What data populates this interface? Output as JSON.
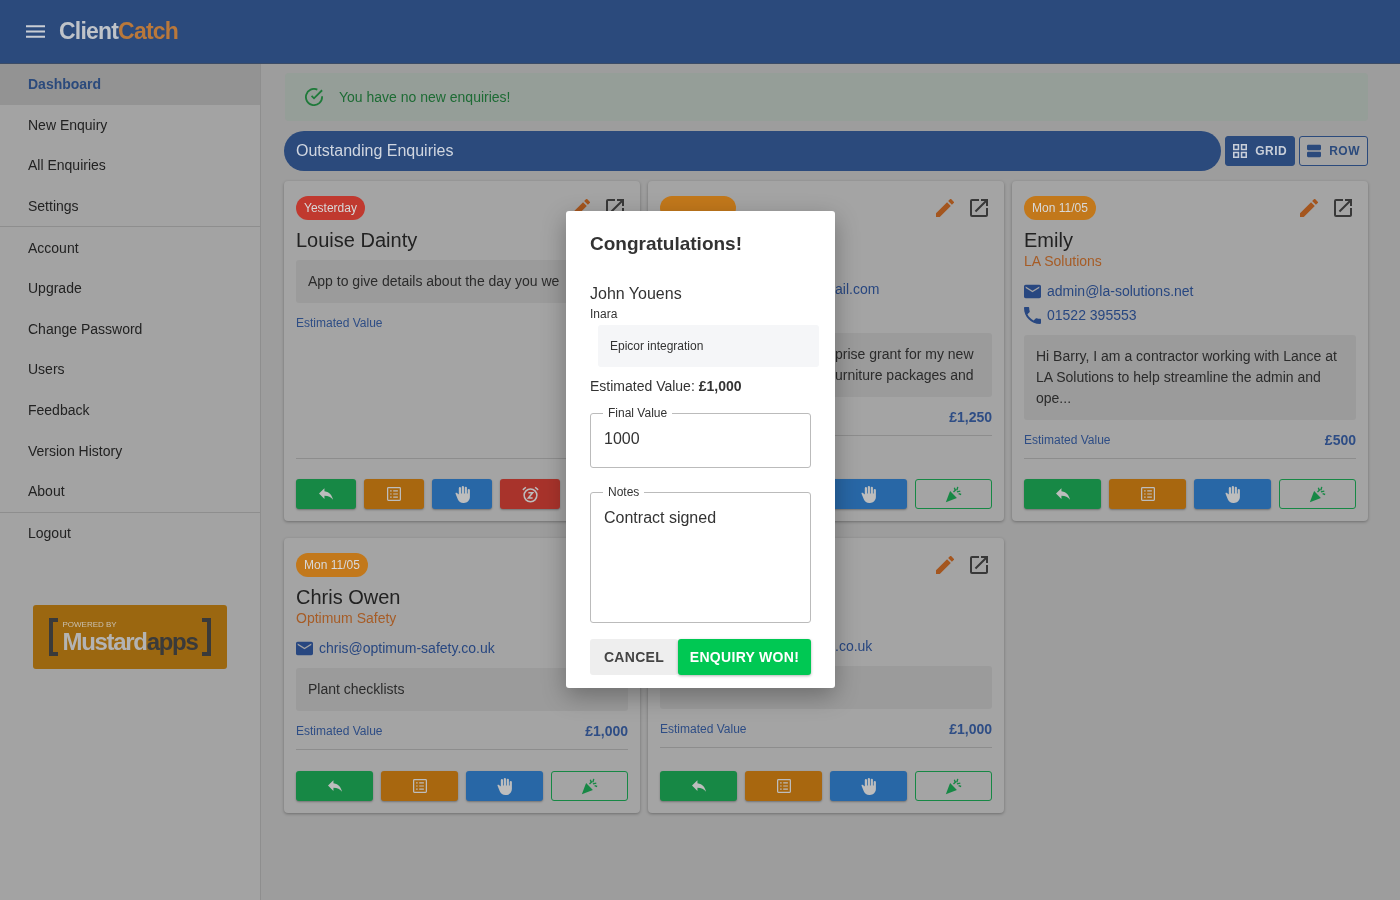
{
  "header": {
    "brand": {
      "primary": "Client",
      "accent": "Catch"
    }
  },
  "sidebar": {
    "groups": [
      [
        {
          "label": "Dashboard",
          "selected": true
        },
        {
          "label": "New Enquiry",
          "selected": false
        },
        {
          "label": "All Enquiries",
          "selected": false
        },
        {
          "label": "Settings",
          "selected": false
        }
      ],
      [
        {
          "label": "Account",
          "selected": false
        },
        {
          "label": "Upgrade",
          "selected": false
        },
        {
          "label": "Change Password",
          "selected": false
        },
        {
          "label": "Users",
          "selected": false
        },
        {
          "label": "Feedback",
          "selected": false
        },
        {
          "label": "Version History",
          "selected": false
        },
        {
          "label": "About",
          "selected": false
        }
      ],
      [
        {
          "label": "Logout",
          "selected": false
        }
      ]
    ],
    "powered_by": {
      "caption": "POWERED BY",
      "name": "Mustard",
      "accent": "apps"
    }
  },
  "alert": {
    "text": "You have no new enquiries!"
  },
  "section": {
    "title": "Outstanding Enquiries"
  },
  "view_toggle": [
    {
      "label": "GRID",
      "kind": "grid",
      "selected": true
    },
    {
      "label": "ROW",
      "kind": "row",
      "selected": false
    }
  ],
  "cards": [
    {
      "badge": {
        "text": "Yesterday",
        "color": "#c0392f"
      },
      "editable": true,
      "name": "Louise Dainty",
      "description": [
        "App to give details about the day you we"
      ],
      "value_label": "Estimated Value",
      "actions": [
        {
          "kind": "reply"
        },
        {
          "kind": "notes"
        },
        {
          "kind": "hold"
        },
        {
          "kind": "snooze"
        }
      ]
    },
    {
      "badge": {
        "color": "#c2781b"
      },
      "editable": true,
      "email": "ail.com",
      "description": [
        "prise grant for my new",
        "urniture packages and"
      ],
      "value": "£1,250",
      "actions": [
        {
          "kind": "hold"
        },
        {
          "kind": "won"
        }
      ]
    },
    {
      "badge": {
        "text": "Mon 11/05",
        "color": "#c2781b"
      },
      "editable": true,
      "name": "Emily",
      "company": "LA Solutions",
      "email": "admin@la-solutions.net",
      "phone": "01522 395553",
      "description": [
        "Hi Barry, I am a contractor working with Lance at LA Solutions to help streamline the admin and ope..."
      ],
      "value_label": "Estimated Value",
      "value": "£500",
      "actions": [
        {
          "kind": "reply"
        },
        {
          "kind": "notes"
        },
        {
          "kind": "hold"
        },
        {
          "kind": "won"
        }
      ]
    },
    {
      "badge": {
        "text": "Mon 11/05",
        "color": "#c2781b"
      },
      "name": "Chris Owen",
      "company": "Optimum Safety",
      "email": "chris@optimum-safety.co.uk",
      "description": [
        "Plant checklists"
      ],
      "value_label": "Estimated Value",
      "value": "£1,000",
      "actions": [
        {
          "kind": "reply"
        },
        {
          "kind": "notes"
        },
        {
          "kind": "hold"
        },
        {
          "kind": "won"
        }
      ]
    },
    {
      "editable": true,
      "email": ".co.uk",
      "value_label": "Estimated Value",
      "value": "£1,000",
      "actions": [
        {
          "kind": "reply"
        },
        {
          "kind": "notes"
        },
        {
          "kind": "hold"
        },
        {
          "kind": "won"
        }
      ]
    }
  ],
  "dialog": {
    "title": "Congratulations!",
    "name": "John Youens",
    "company": "Inara",
    "description": "Epicor integration",
    "estimate": "Estimated Value: **£1,000**",
    "final_value": {
      "label": "Final Value",
      "value": "1000"
    },
    "notes": {
      "label": "Notes",
      "value": "Contract signed"
    },
    "buttons": [
      {
        "label": "CANCEL",
        "kind": "cancel"
      },
      {
        "label": "ENQUIRY WON!",
        "kind": "confirm"
      }
    ]
  }
}
